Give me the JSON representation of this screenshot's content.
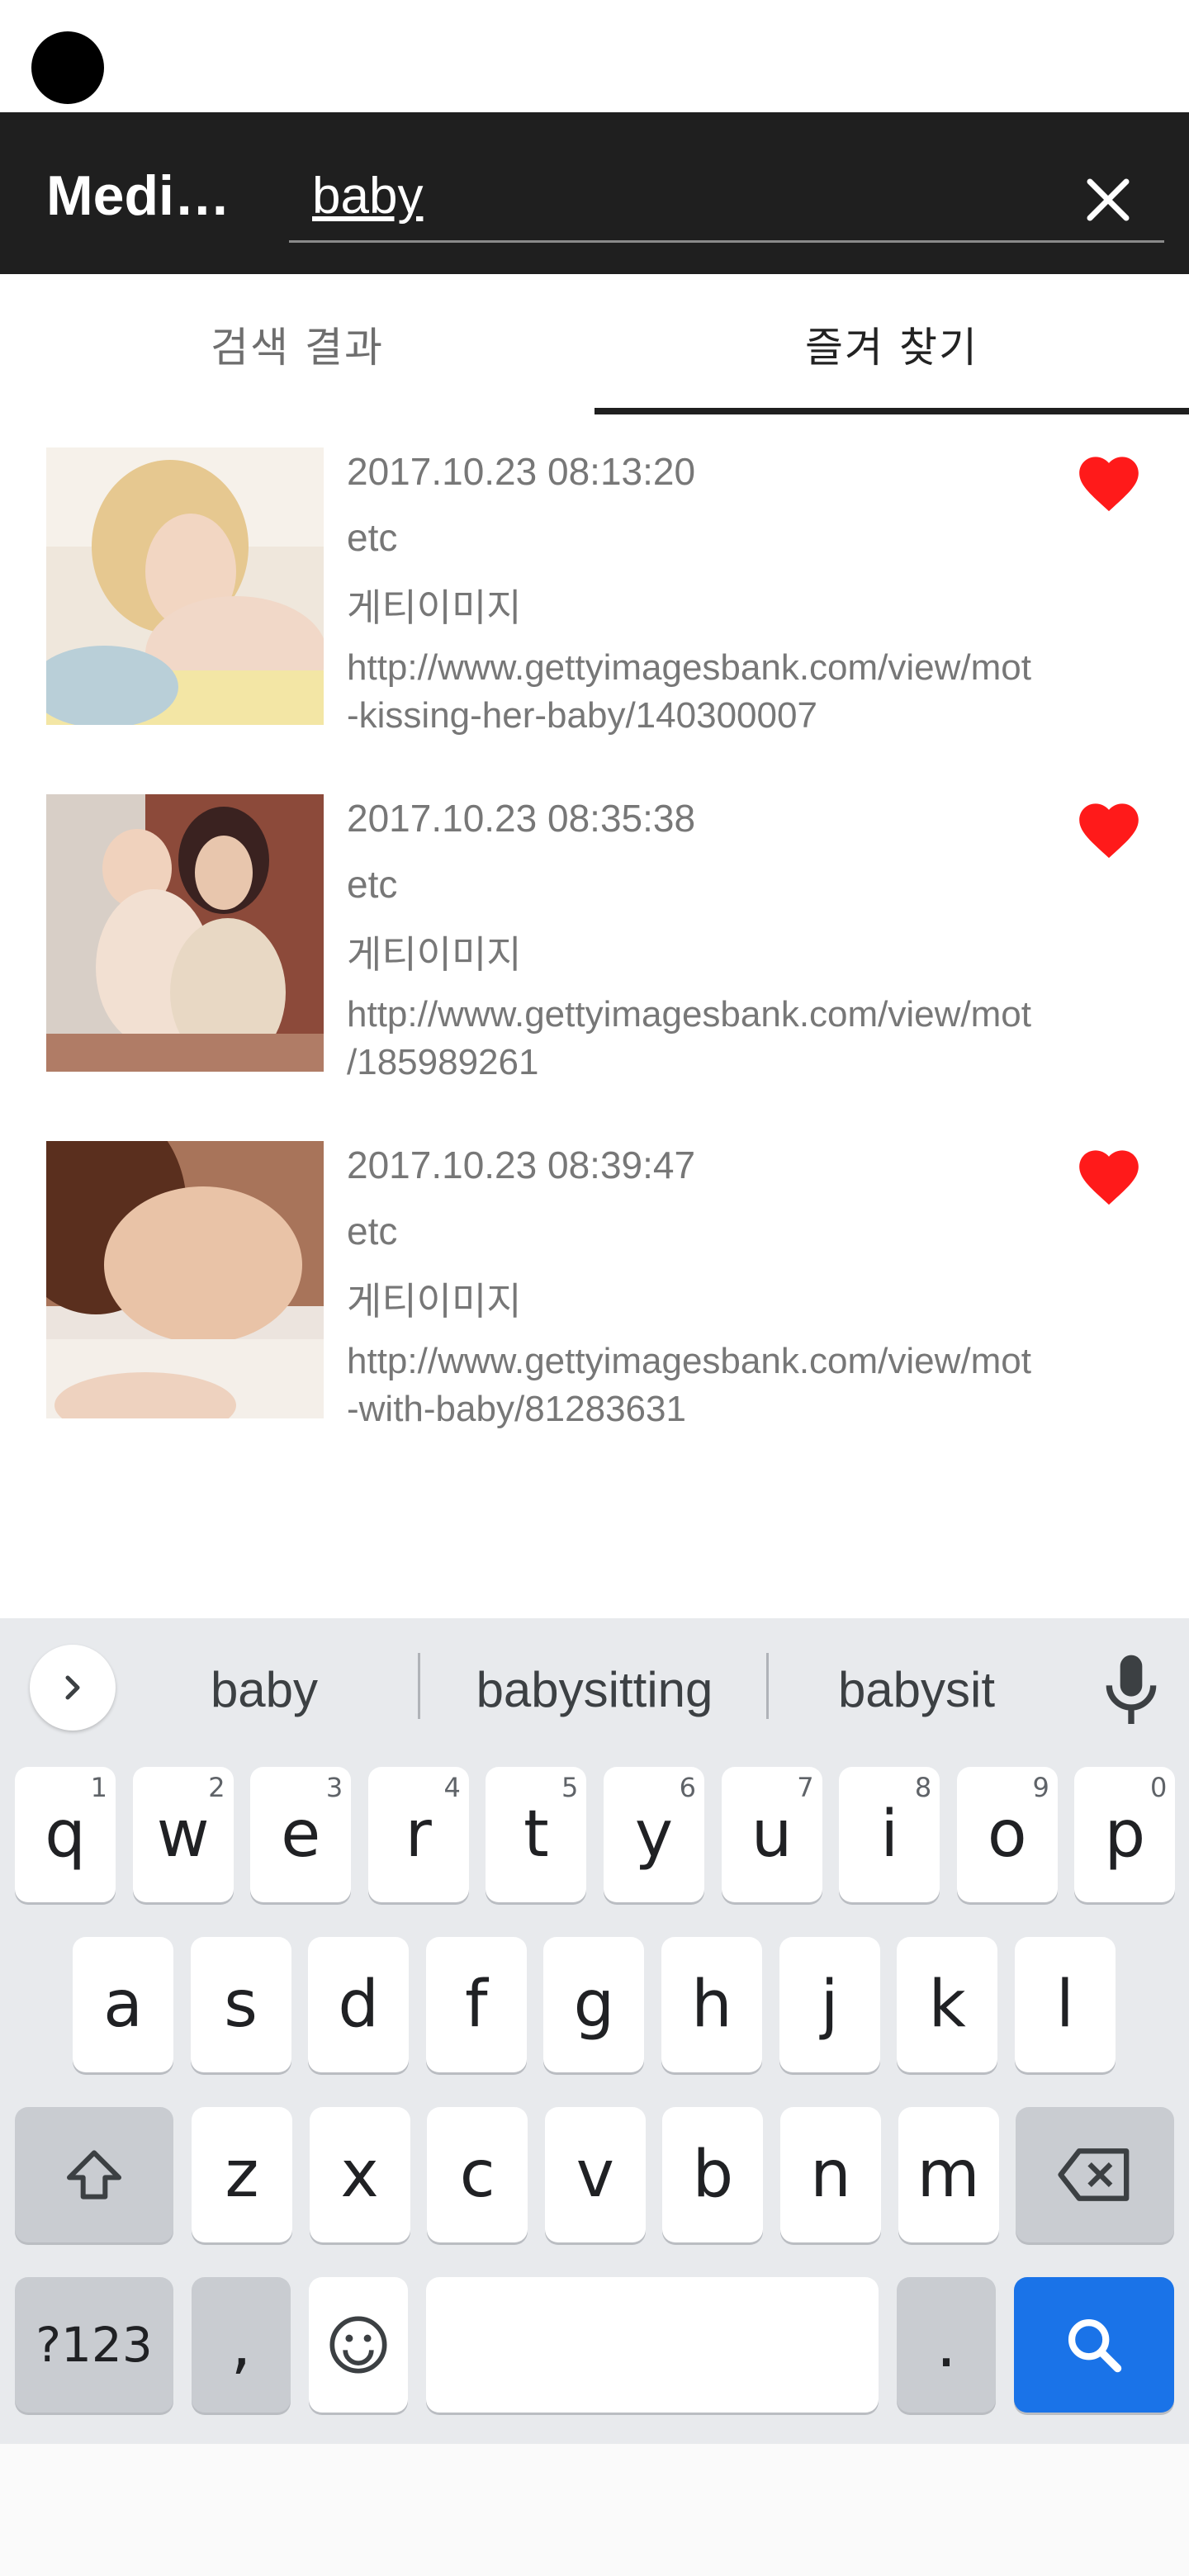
{
  "app": {
    "title": "Medi…"
  },
  "search": {
    "query": "baby"
  },
  "tabs": [
    {
      "label": "검색 결과"
    },
    {
      "label": "즐겨 찾기"
    }
  ],
  "results": [
    {
      "date": "2017.10.23 08:13:20",
      "category": "etc",
      "source": "게티이미지",
      "url": "http://www.gettyimagesbank.com/view/mot\n-kissing-her-baby/140300007"
    },
    {
      "date": "2017.10.23 08:35:38",
      "category": "etc",
      "source": "게티이미지",
      "url": "http://www.gettyimagesbank.com/view/mot\n/185989261"
    },
    {
      "date": "2017.10.23 08:39:47",
      "category": "etc",
      "source": "게티이미지",
      "url": "http://www.gettyimagesbank.com/view/mot\n-with-baby/81283631"
    }
  ],
  "keyboard": {
    "suggestions": [
      "baby",
      "babysitting",
      "babysit"
    ],
    "row1": [
      {
        "k": "q",
        "h": "1"
      },
      {
        "k": "w",
        "h": "2"
      },
      {
        "k": "e",
        "h": "3"
      },
      {
        "k": "r",
        "h": "4"
      },
      {
        "k": "t",
        "h": "5"
      },
      {
        "k": "y",
        "h": "6"
      },
      {
        "k": "u",
        "h": "7"
      },
      {
        "k": "i",
        "h": "8"
      },
      {
        "k": "o",
        "h": "9"
      },
      {
        "k": "p",
        "h": "0"
      }
    ],
    "row2": [
      "a",
      "s",
      "d",
      "f",
      "g",
      "h",
      "j",
      "k",
      "l"
    ],
    "row3": [
      "z",
      "x",
      "c",
      "v",
      "b",
      "n",
      "m"
    ],
    "symbols_label": "?123",
    "comma": ",",
    "period": "."
  },
  "colors": {
    "app_bar": "#1f1f1f",
    "heart": "#ff1a1a",
    "accent": "#1a73e8"
  }
}
